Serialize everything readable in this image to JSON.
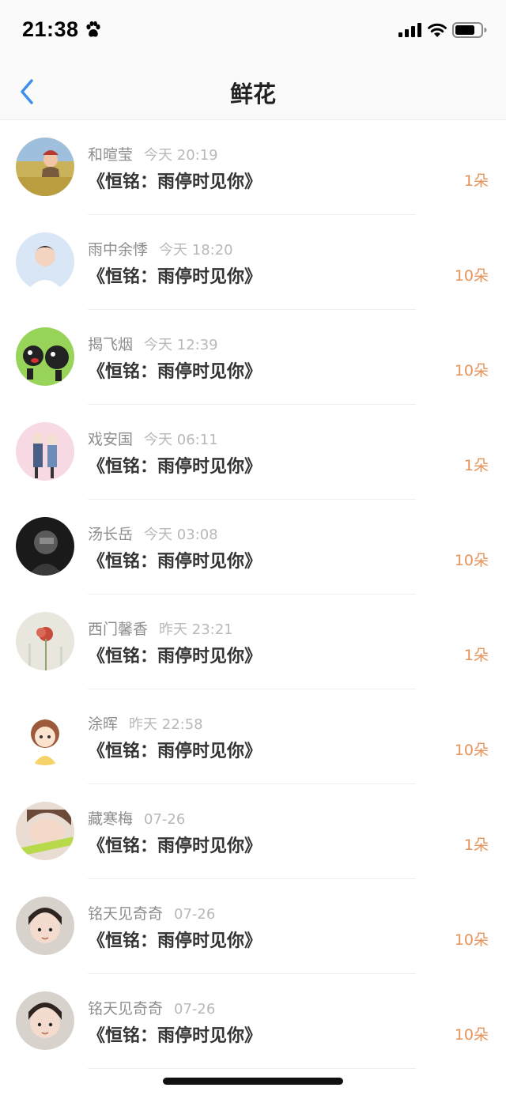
{
  "status_bar": {
    "time": "21:38"
  },
  "nav": {
    "title": "鲜花"
  },
  "records": [
    {
      "name": "和暄莹",
      "time": "今天 20:19",
      "book": "《恒铭：雨停时见你》",
      "count": "1朵",
      "avatar": "girl-field"
    },
    {
      "name": "雨中余悸",
      "time": "今天 18:20",
      "book": "《恒铭：雨停时见你》",
      "count": "10朵",
      "avatar": "boy-portrait"
    },
    {
      "name": "揭飞烟",
      "time": "今天 12:39",
      "book": "《恒铭：雨停时见你》",
      "count": "10朵",
      "avatar": "cartoon-dogs"
    },
    {
      "name": "戏安国",
      "time": "今天 06:11",
      "book": "《恒铭：雨停时见你》",
      "count": "1朵",
      "avatar": "anime-couple"
    },
    {
      "name": "汤长岳",
      "time": "今天 03:08",
      "book": "《恒铭：雨停时见你》",
      "count": "10朵",
      "avatar": "dark-figure"
    },
    {
      "name": "西门馨香",
      "time": "昨天 23:21",
      "book": "《恒铭：雨停时见你》",
      "count": "1朵",
      "avatar": "red-flower"
    },
    {
      "name": "涂晖",
      "time": "昨天 22:58",
      "book": "《恒铭：雨停时见你》",
      "count": "10朵",
      "avatar": "chibi-girl"
    },
    {
      "name": "藏寒梅",
      "time": "07-26",
      "book": "《恒铭：雨停时见你》",
      "count": "1朵",
      "avatar": "sleeping-girl"
    },
    {
      "name": "铭天见奇奇",
      "time": "07-26",
      "book": "《恒铭：雨停时见你》",
      "count": "10朵",
      "avatar": "child-face"
    },
    {
      "name": "铭天见奇奇",
      "time": "07-26",
      "book": "《恒铭：雨停时见你》",
      "count": "10朵",
      "avatar": "child-face"
    }
  ],
  "colors": {
    "count": "#e6925b",
    "back_arrow": "#3b8fe6",
    "name": "#8e8e8e",
    "time": "#b8b8b8"
  }
}
